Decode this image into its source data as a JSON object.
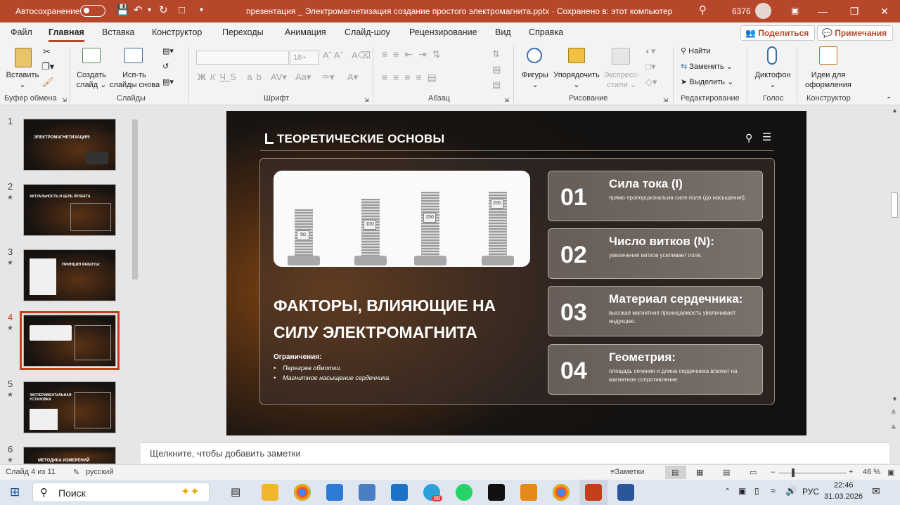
{
  "titlebar": {
    "autosave_label": "Автосохранение",
    "document_title": "презентация _ Электромагнетизация создание простого электромагнита.pptx  ·  Сохранено в: этот компьютер",
    "user_id": "6376"
  },
  "menu": {
    "tabs": [
      "Файл",
      "Главная",
      "Вставка",
      "Конструктор",
      "Переходы",
      "Анимация",
      "Слайд-шоу",
      "Рецензирование",
      "Вид",
      "Справка"
    ],
    "share_label": "Поделиться",
    "comments_label": "Примечания"
  },
  "ribbon": {
    "clipboard": {
      "paste": "Вставить",
      "group": "Буфер обмена"
    },
    "slides": {
      "new_slide_line1": "Создать",
      "new_slide_line2": "слайд",
      "reuse_line1": "Исп-ть",
      "reuse_line2": "слайды снова",
      "group": "Слайды"
    },
    "font": {
      "size": "18+",
      "group": "Шрифт"
    },
    "paragraph": {
      "group": "Абзац"
    },
    "drawing": {
      "shapes": "Фигуры",
      "arrange": "Упорядочить",
      "styles_line1": "Экспресс-",
      "styles_line2": "стили",
      "group": "Рисование"
    },
    "editing": {
      "find": "Найти",
      "replace": "Заменить",
      "select": "Выделить",
      "group": "Редактирование"
    },
    "voice": {
      "dictate": "Диктофон",
      "group": "Голос"
    },
    "designer": {
      "ideas_line1": "Идеи для",
      "ideas_line2": "оформления",
      "group": "Конструктор"
    }
  },
  "thumbnails": {
    "numbers": [
      "1",
      "2",
      "3",
      "4",
      "5",
      "6"
    ],
    "slide1_title": "ЭЛЕКТРОМАГНЕТИЗАЦИЯ:",
    "slide2_title": "АКТУАЛЬНОСТЬ И ЦЕЛЬ ПРОЕКТА",
    "slide3_title": "ПРИНЦИП РАБОТЫ:",
    "slide5_title": "ЭКСПЕРИМЕНТАЛЬНАЯ УСТАНОВКА",
    "slide6_title": "МЕТОДИКА ИЗМЕРЕНИЙ"
  },
  "slide": {
    "header_title": "ТЕОРЕТИЧЕСКИЕ ОСНОВЫ",
    "main_title": "ФАКТОРЫ, ВЛИЯЮЩИЕ НА СИЛУ ЭЛЕКТРОМАГНИТА",
    "limits_heading": "Ограничения:",
    "limits": [
      "Перегрев обмотки.",
      "Магнитное насыщение сердечника."
    ],
    "photo_labels": [
      "50",
      "100",
      "150",
      "200"
    ],
    "cards": [
      {
        "num": "01",
        "title": "Сила тока (I)",
        "desc": "прямо пропорциональна силе поля (до насыщения)."
      },
      {
        "num": "02",
        "title": "Число витков (N):",
        "desc": "увеличение витков усиливает поле."
      },
      {
        "num": "03",
        "title": "Материал сердечника:",
        "desc": "высокая магнитная проницаемость увеличивает индукцию."
      },
      {
        "num": "04",
        "title": "Геометрия:",
        "desc": "площадь сечения и длина сердечника влияют на магнитное сопротивление."
      }
    ]
  },
  "notes_placeholder": "Щелкните, чтобы добавить заметки",
  "status": {
    "slide_counter": "Слайд 4 из 11",
    "language": "русский",
    "notes_button": "Заметки",
    "zoom": "46 %"
  },
  "taskbar": {
    "search": "Поиск",
    "telegram_badge": "99",
    "lang": "РУС",
    "time": "22:46",
    "date": "31.03.2026"
  },
  "colors": {
    "accent": "#b7472a",
    "slide_bg": "#1a1512"
  }
}
